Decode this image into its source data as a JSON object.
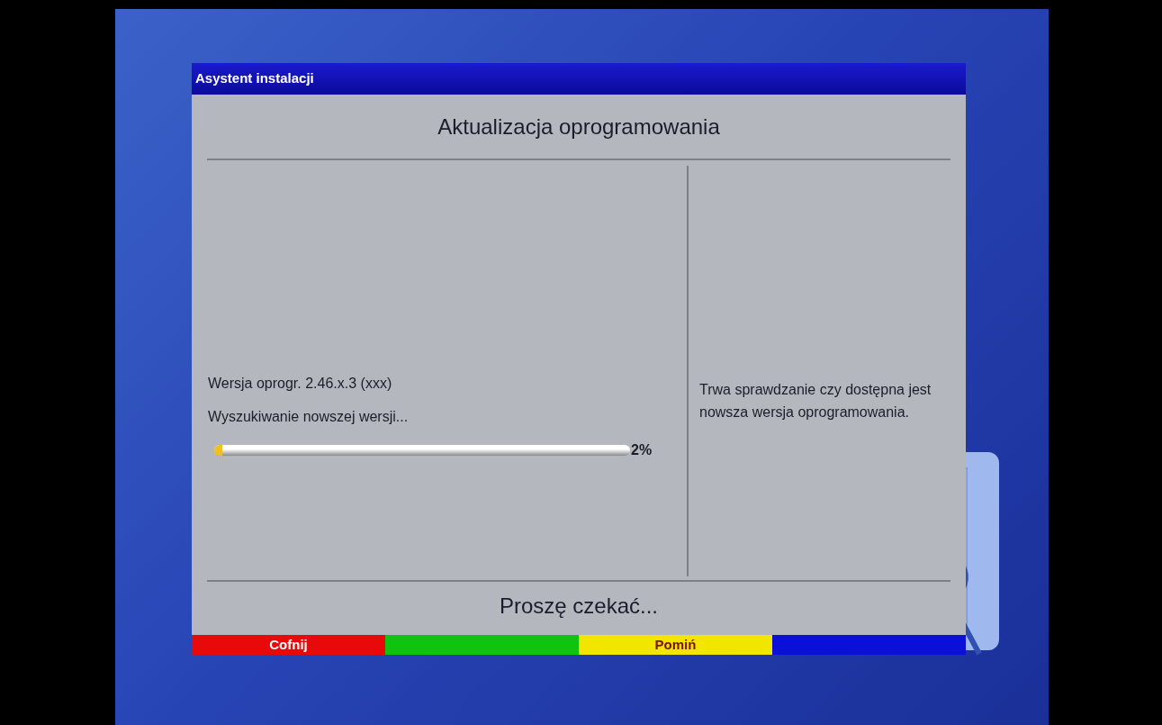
{
  "window": {
    "title": "Asystent instalacji"
  },
  "heading": "Aktualizacja oprogramowania",
  "status": {
    "version": "Wersja oprogr. 2.46.x.3 (xxx)",
    "activity": "Wyszukiwanie nowszej wersji...",
    "progress": {
      "level": 0.02,
      "reading": "2%"
    }
  },
  "help_text": "Trwa sprawdzanie czy dostępna jest nowsza wersja oprogramowania.",
  "footer_message": "Proszę czekać...",
  "color_keys": [
    {
      "color": "#e80a0a",
      "label": "Cofnij"
    },
    {
      "color": "#0fc40f"
    },
    {
      "color": "#f2e600",
      "label": "Pomiń"
    },
    {
      "color": "#0a10d8"
    }
  ]
}
